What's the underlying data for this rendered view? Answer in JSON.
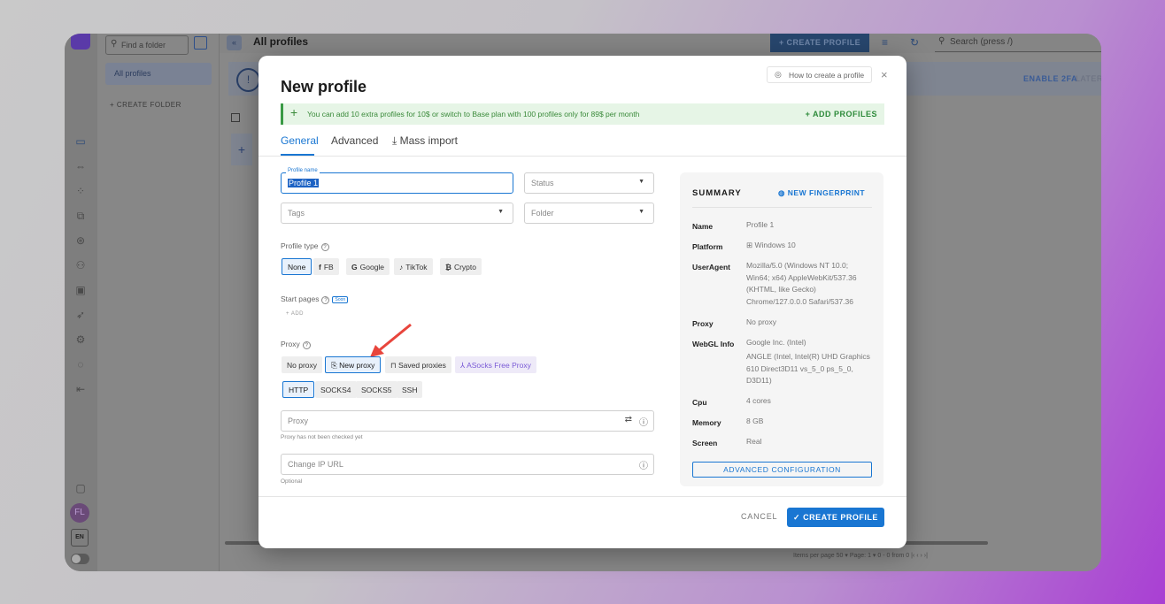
{
  "app": {
    "search_folder_placeholder": "Find a folder",
    "all_profiles_folder": "All profiles",
    "create_folder": "+ CREATE FOLDER",
    "page_title": "All profiles",
    "create_profile_top": "+ CREATE PROFILE",
    "search_placeholder": "Search (press /)",
    "enable_2fa": "ENABLE 2FA",
    "later": "LATER",
    "avatar_initials": "FL",
    "language": "EN",
    "pager": "Items per page  50  ▾      Page:  1  ▾      0 - 0 from 0  |‹  ‹   ›  ›|"
  },
  "modal": {
    "title": "New profile",
    "how_to": "How to create a profile",
    "promo_text": "You can add 10 extra profiles for 10$ or switch to Base plan with 100 profiles only for 89$ per month",
    "add_profiles": "+ ADD PROFILES",
    "tabs": [
      {
        "label": "General"
      },
      {
        "label": "Advanced"
      },
      {
        "label": "⤓ Mass import"
      }
    ],
    "profile_name_label": "Profile name",
    "profile_name_value": "Profile 1",
    "status_placeholder": "Status",
    "tags_placeholder": "Tags",
    "folder_placeholder": "Folder",
    "profile_type_label": "Profile type",
    "profile_types": [
      "None",
      "FB",
      "Google",
      "TikTok",
      "Crypto"
    ],
    "start_pages_label": "Start pages",
    "soon_badge": "Soon",
    "add_start_page": "+ ADD",
    "proxy_label": "Proxy",
    "proxy_options": [
      "No proxy",
      "New proxy",
      "Saved proxies",
      "ASocks Free Proxy"
    ],
    "proxy_protocols": [
      "HTTP",
      "SOCKS4",
      "SOCKS5",
      "SSH"
    ],
    "proxy_input_placeholder": "Proxy",
    "proxy_hint": "Proxy has not been checked yet",
    "change_ip_placeholder": "Change IP URL",
    "change_ip_hint": "Optional",
    "cancel": "CANCEL",
    "create": "✓ CREATE PROFILE"
  },
  "summary": {
    "title": "SUMMARY",
    "new_fingerprint": "NEW FINGERPRINT",
    "rows": [
      {
        "key": "Name",
        "value": "Profile 1"
      },
      {
        "key": "Platform",
        "value": "Windows 10"
      },
      {
        "key": "UserAgent",
        "value": "Mozilla/5.0 (Windows NT 10.0; Win64; x64) AppleWebKit/537.36 (KHTML, like Gecko) Chrome/127.0.0.0 Safari/537.36"
      },
      {
        "key": "Proxy",
        "value": "No proxy"
      },
      {
        "key": "WebGL Info",
        "value": "Google Inc. (Intel)"
      },
      {
        "key": "",
        "value": "ANGLE (Intel, Intel(R) UHD Graphics 610 Direct3D11 vs_5_0 ps_5_0, D3D11)"
      },
      {
        "key": "Cpu",
        "value": "4 cores"
      },
      {
        "key": "Memory",
        "value": "8 GB"
      },
      {
        "key": "Screen",
        "value": "Real"
      }
    ],
    "advanced_config": "ADVANCED CONFIGURATION"
  },
  "colors": {
    "accent": "#1976d2",
    "promo_green": "#3a9a45",
    "arrow_red": "#e8453c"
  }
}
